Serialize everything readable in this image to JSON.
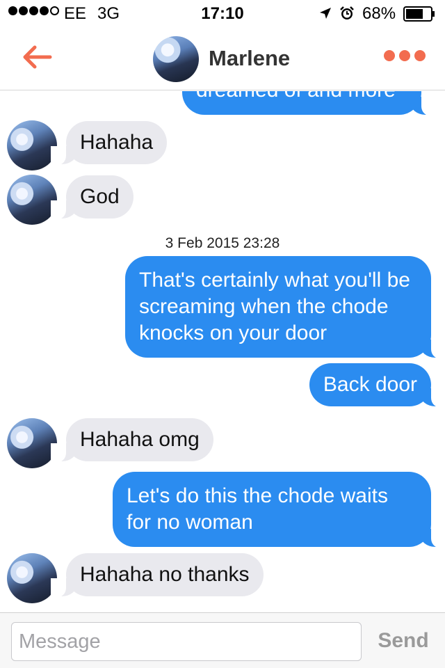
{
  "status_bar": {
    "carrier": "EE",
    "network": "3G",
    "time": "17:10",
    "battery_percent": "68%",
    "signal_bars_filled": 4,
    "signal_bars_total": 5
  },
  "nav": {
    "contact_name": "Marlene",
    "back_icon": "arrow-left-icon",
    "more_icon": "more-dots-icon",
    "accent_color": "#f26c4f"
  },
  "messages": [
    {
      "direction": "out",
      "text": "dreamed of and more"
    },
    {
      "direction": "in",
      "text": "Hahaha"
    },
    {
      "direction": "in",
      "text": "God"
    },
    {
      "type": "timestamp",
      "text": "3 Feb 2015 23:28"
    },
    {
      "direction": "out",
      "text": "That's certainly what you'll be screaming when the chode knocks on your door"
    },
    {
      "direction": "out",
      "text": "Back door"
    },
    {
      "direction": "in",
      "text": "Hahaha omg"
    },
    {
      "direction": "out",
      "text": "Let's do this the chode waits for no woman"
    },
    {
      "direction": "in",
      "text": "Hahaha no thanks"
    }
  ],
  "composer": {
    "placeholder": "Message",
    "value": "",
    "send_label": "Send"
  },
  "colors": {
    "outgoing_bubble": "#2b8cf0",
    "incoming_bubble": "#e9e9ee",
    "send_disabled": "#9a9a9a"
  }
}
